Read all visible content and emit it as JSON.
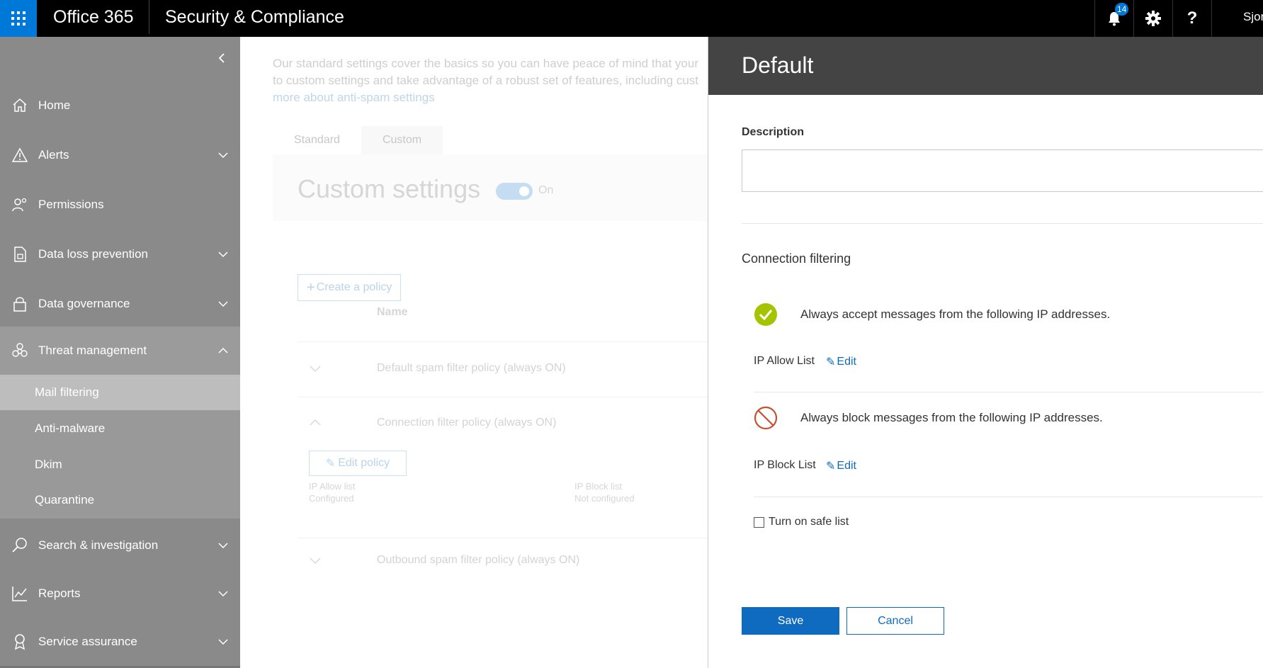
{
  "topbar": {
    "brand": "Office 365",
    "app_title": "Security & Compliance",
    "notification_count": "14",
    "user_name": "Sjor"
  },
  "sidebar": {
    "items": [
      {
        "label": "Home",
        "icon": "home-icon"
      },
      {
        "label": "Alerts",
        "icon": "alert-icon"
      },
      {
        "label": "Permissions",
        "icon": "permissions-icon"
      },
      {
        "label": "Data loss prevention",
        "icon": "data-loss-icon"
      },
      {
        "label": "Data governance",
        "icon": "lock-icon"
      },
      {
        "label": "Threat management",
        "icon": "biohazard-icon"
      },
      {
        "label": "Search & investigation",
        "icon": "search-icon"
      },
      {
        "label": "Reports",
        "icon": "chart-icon"
      },
      {
        "label": "Service assurance",
        "icon": "ribbon-icon"
      }
    ],
    "sub_items": [
      "Mail filtering",
      "Anti-malware",
      "Dkim",
      "Quarantine"
    ],
    "active_sub_item": "Mail filtering"
  },
  "main": {
    "intro_line1": "Our standard settings cover the basics so you can have peace of mind that your",
    "intro_line2": "to custom settings and take advantage of a robust set of features, including cust",
    "intro_link": "more about anti-spam settings",
    "tabs": [
      "Standard",
      "Custom"
    ],
    "active_tab": "Custom",
    "settings_title": "Custom settings",
    "toggle_state": "On",
    "create_policy_label": "Create a policy",
    "column_name": "Name",
    "policies": [
      "Default spam filter policy (always ON)",
      "Connection filter policy (always ON)",
      "Outbound spam filter policy (always ON)"
    ],
    "edit_policy_label": "Edit policy",
    "ip_allow_label": "IP Allow list",
    "ip_allow_value": "Configured",
    "ip_block_label": "IP Block list",
    "ip_block_value": "Not configured"
  },
  "panel": {
    "title": "Default",
    "description_label": "Description",
    "description_value": "",
    "section_title": "Connection filtering",
    "allow_text": "Always accept messages from the following IP addresses.",
    "allow_list_label": "IP Allow List",
    "block_text": "Always block messages from the following IP addresses.",
    "block_list_label": "IP Block List",
    "edit_label": "Edit",
    "safe_list_label": "Turn on safe list",
    "safe_list_checked": false,
    "save_label": "Save",
    "cancel_label": "Cancel"
  },
  "colors": {
    "accent": "#0078d7",
    "allow_green": "#a4c400",
    "block_red": "#c8502f"
  }
}
